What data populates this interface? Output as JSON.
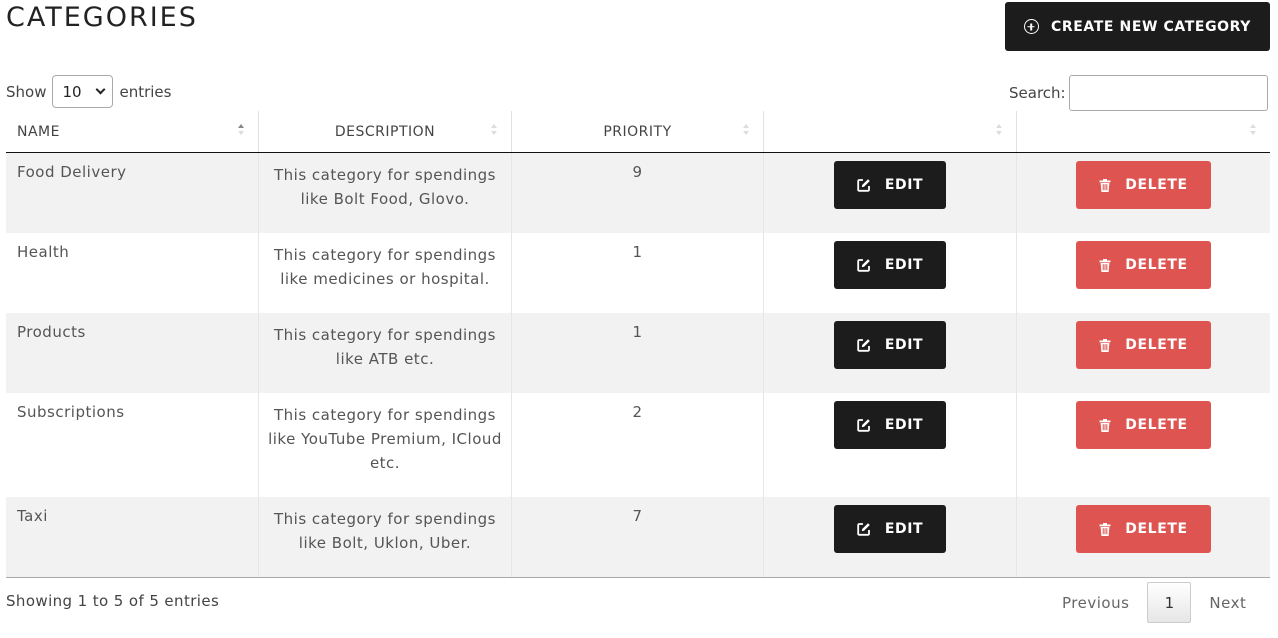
{
  "page": {
    "title": "CATEGORIES",
    "create_button": "CREATE NEW CATEGORY"
  },
  "length": {
    "show_label": "Show",
    "value": "10",
    "entries_label": "entries"
  },
  "search": {
    "label": "Search:",
    "value": ""
  },
  "table": {
    "headers": [
      "NAME",
      "DESCRIPTION",
      "PRIORITY",
      "",
      ""
    ],
    "sort_active": "NAME",
    "edit_label": "EDIT",
    "delete_label": "DELETE",
    "rows": [
      {
        "name": "Food Delivery",
        "description": "This category for spendings like Bolt Food, Glovo.",
        "priority": "9"
      },
      {
        "name": "Health",
        "description": "This category for spendings like medicines or hospital.",
        "priority": "1"
      },
      {
        "name": "Products",
        "description": "This category for spendings like ATB etc.",
        "priority": "1"
      },
      {
        "name": "Subscriptions",
        "description": "This category for spendings like YouTube Premium, ICloud etc.",
        "priority": "2"
      },
      {
        "name": "Taxi",
        "description": "This category for spendings like Bolt, Uklon, Uber.",
        "priority": "7"
      }
    ]
  },
  "footer": {
    "info": "Showing 1 to 5 of 5 entries",
    "previous": "Previous",
    "page": "1",
    "next": "Next"
  },
  "colors": {
    "dark_button": "#1c1c1c",
    "delete_button": "#dd5450",
    "stripe": "#f2f2f2"
  },
  "icons": {
    "create": "plus-circle-icon",
    "edit": "edit-icon",
    "delete": "trash-icon"
  }
}
